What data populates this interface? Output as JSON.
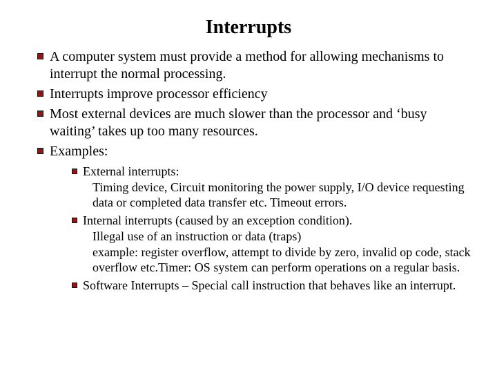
{
  "title": "Interrupts",
  "items": [
    "A computer system must provide a method for allowing mechanisms to interrupt the normal processing.",
    "Interrupts improve processor efficiency",
    "Most external devices are much slower than the processor and ‘busy waiting’ takes up too many resources.",
    "Examples:"
  ],
  "examples": [
    {
      "head": "External interrupts:",
      "body": "Timing device, Circuit monitoring the power supply, I/O device requesting data or completed data transfer etc. Timeout errors."
    },
    {
      "head": "Internal interrupts (caused by an exception condition).",
      "body1": "Illegal use of an instruction or data  (traps)",
      "body2": "example: register overflow, attempt to divide by zero, invalid op code, stack overflow etc.Timer: OS system can perform operations on a regular basis."
    },
    {
      "head": "Software Interrupts – Special call instruction that behaves like an interrupt."
    }
  ]
}
